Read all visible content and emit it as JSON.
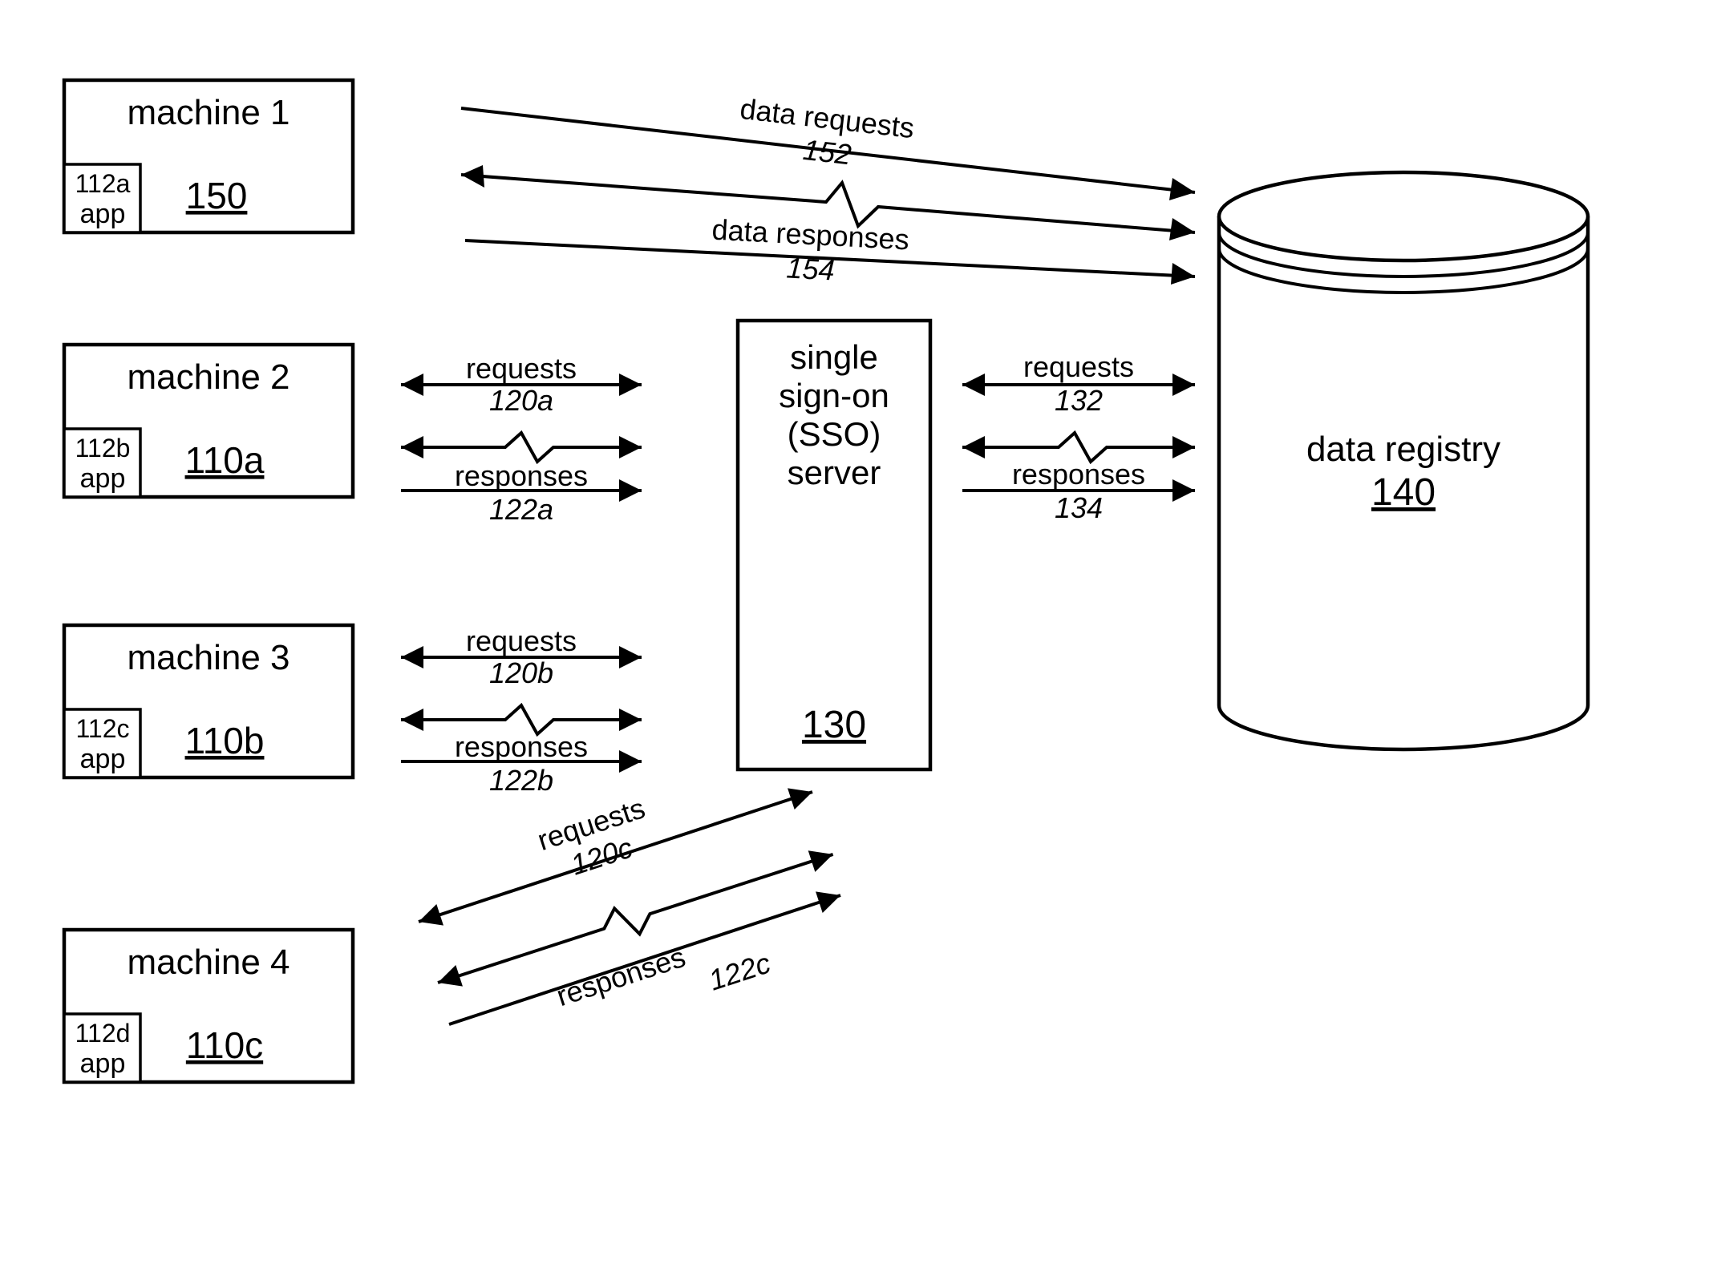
{
  "machines": [
    {
      "title": "machine 1",
      "app_id": "112a",
      "app_label": "app",
      "ref": "150"
    },
    {
      "title": "machine 2",
      "app_id": "112b",
      "app_label": "app",
      "ref": "110a"
    },
    {
      "title": "machine 3",
      "app_id": "112c",
      "app_label": "app",
      "ref": "110b"
    },
    {
      "title": "machine 4",
      "app_id": "112d",
      "app_label": "app",
      "ref": "110c"
    }
  ],
  "sso": {
    "line1": "single",
    "line2": "sign-on",
    "line3": "(SSO)",
    "line4": "server",
    "ref": "130"
  },
  "registry": {
    "label": "data registry",
    "ref": "140"
  },
  "flows": {
    "top_req": {
      "label": "data requests",
      "ref": "152"
    },
    "top_resp": {
      "label": "data responses",
      "ref": "154"
    },
    "m2_req": {
      "label": "requests",
      "ref": "120a"
    },
    "m2_resp": {
      "label": "responses",
      "ref": "122a"
    },
    "m3_req": {
      "label": "requests",
      "ref": "120b"
    },
    "m3_resp": {
      "label": "responses",
      "ref": "122b"
    },
    "m4_req": {
      "label": "requests",
      "ref": "120c"
    },
    "m4_resp": {
      "label": "responses",
      "ref": "122c"
    },
    "sr_req": {
      "label": "requests",
      "ref": "132"
    },
    "sr_resp": {
      "label": "responses",
      "ref": "134"
    }
  }
}
